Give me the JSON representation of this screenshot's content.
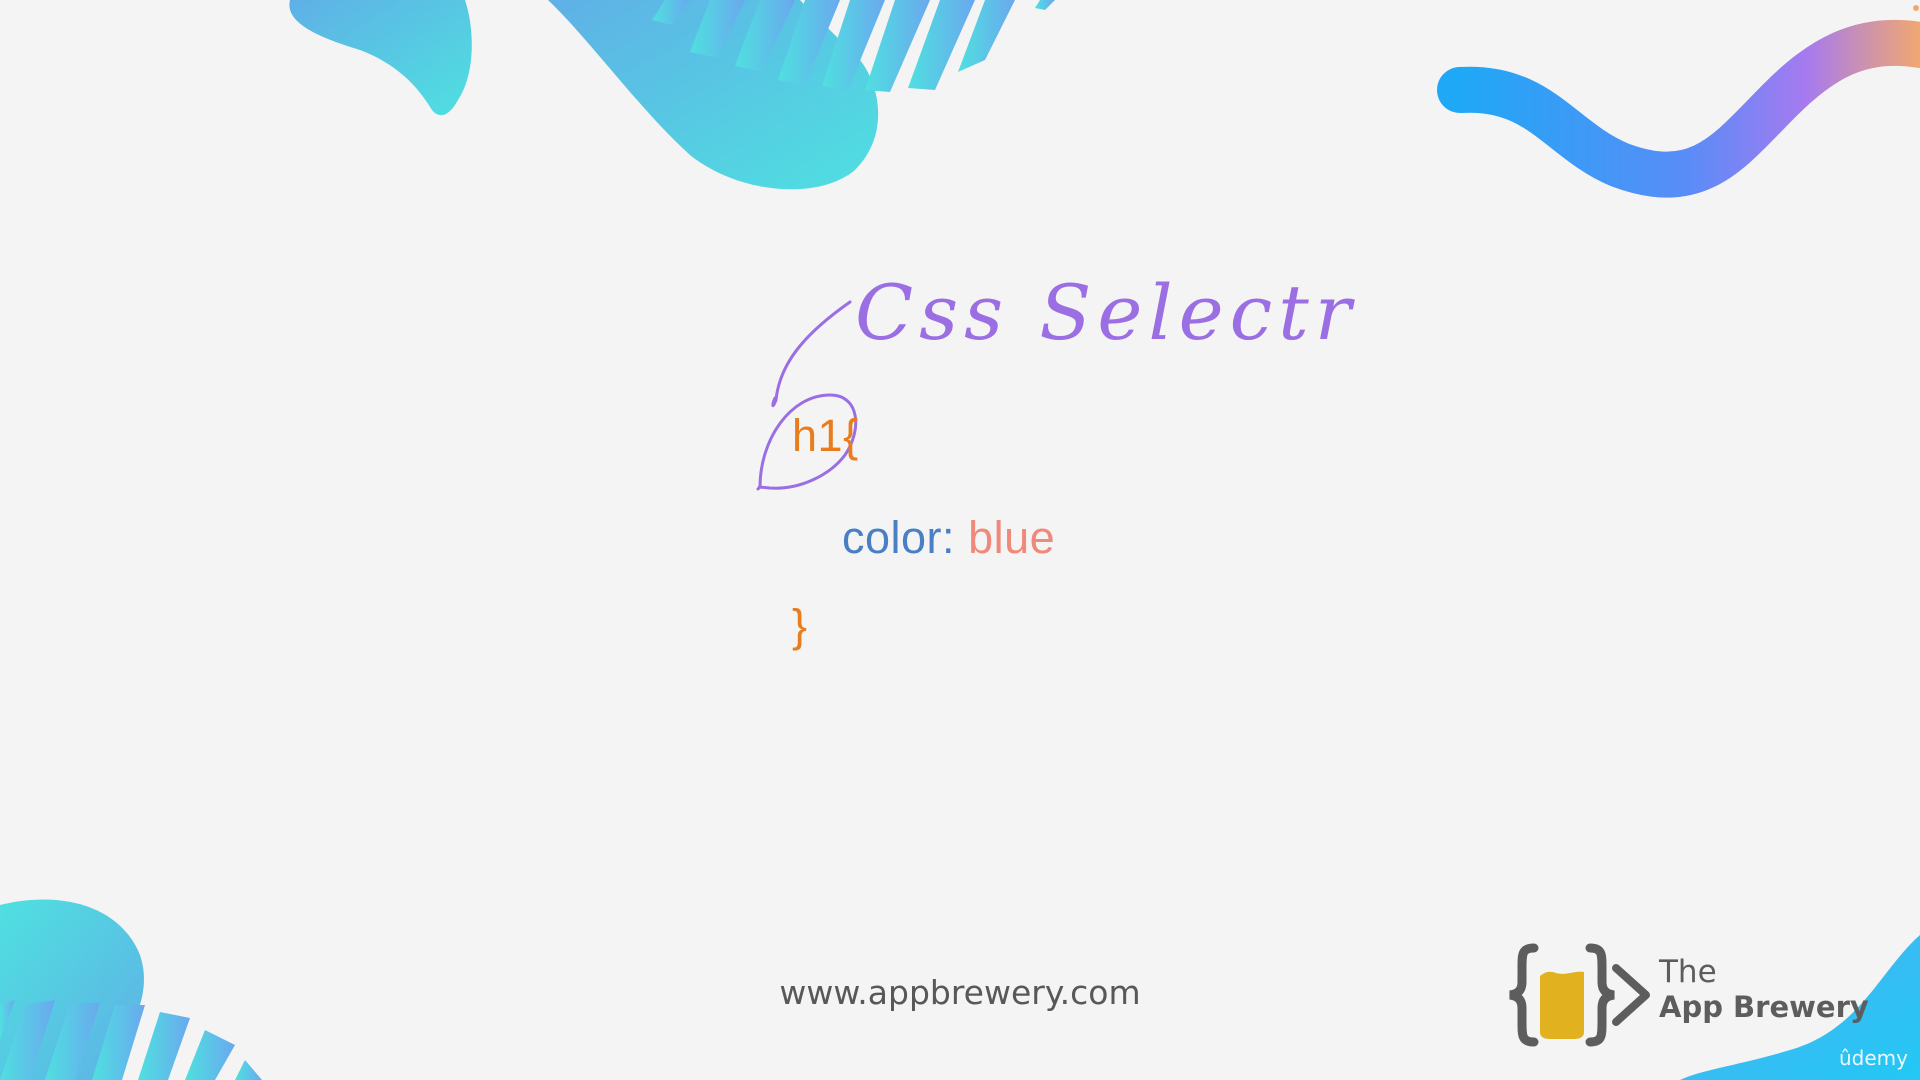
{
  "slide": {
    "code": {
      "selector": "h1",
      "open_brace": "{",
      "property": "color",
      "colon": ":",
      "value": "blue",
      "close_brace": "}"
    },
    "annotation": "Css Selectr",
    "footer_url": "www.appbrewery.com",
    "brand": {
      "the": "The",
      "name": "App Brewery"
    },
    "watermark": "ûdemy"
  },
  "colors": {
    "background": "#f4f4f4",
    "selector": "#e87d1e",
    "property": "#4a7fc6",
    "value": "#ef8a7a",
    "annotation": "#9b6ee3",
    "brand_text": "#5d5d5d",
    "logo_cup": "#e2b11f"
  },
  "icons": [
    "code-braces-logo-icon",
    "chevron-right-icon"
  ]
}
